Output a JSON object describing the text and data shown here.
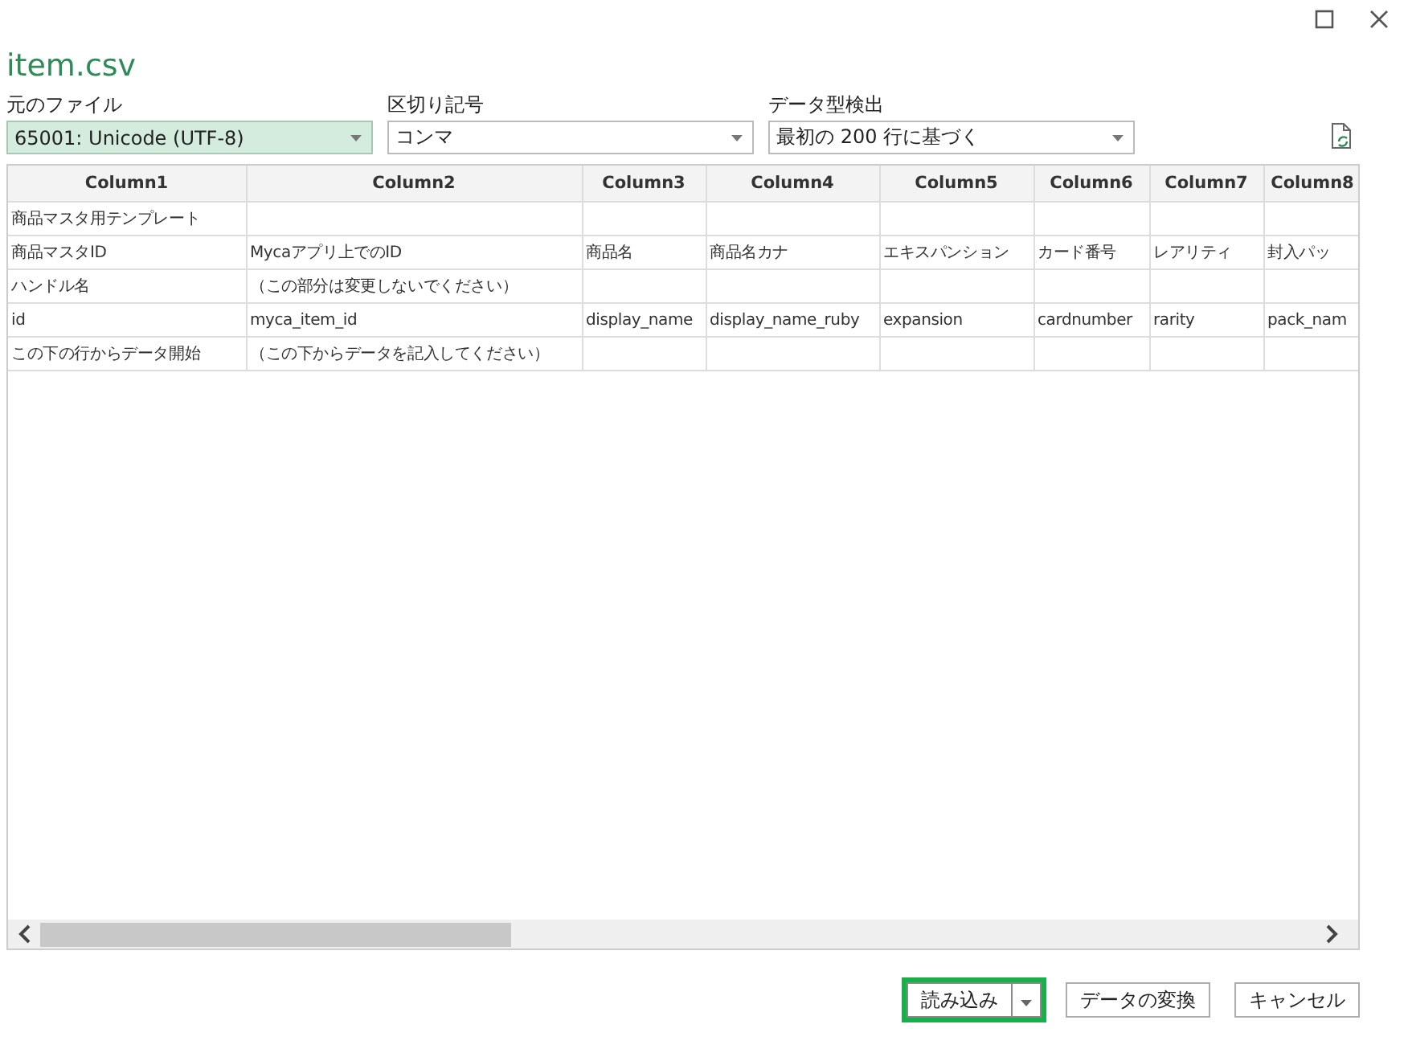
{
  "window": {
    "title": "item.csv"
  },
  "options": [
    {
      "label": "元のファイル",
      "value": "65001: Unicode (UTF-8)",
      "selected": true
    },
    {
      "label": "区切り記号",
      "value": "コンマ",
      "selected": false
    },
    {
      "label": "データ型検出",
      "value": "最初の 200 行に基づく",
      "selected": false
    }
  ],
  "table": {
    "columns": [
      "Column1",
      "Column2",
      "Column3",
      "Column4",
      "Column5",
      "Column6",
      "Column7",
      "Column8"
    ],
    "rows": [
      [
        "商品マスタ用テンプレート",
        "",
        "",
        "",
        "",
        "",
        "",
        ""
      ],
      [
        "商品マスタID",
        "Mycaアプリ上でのID",
        "商品名",
        "商品名カナ",
        "エキスパンション",
        "カード番号",
        "レアリティ",
        "封入パッ"
      ],
      [
        "ハンドル名",
        "（この部分は変更しないでください）",
        "",
        "",
        "",
        "",
        "",
        ""
      ],
      [
        "id",
        "myca_item_id",
        "display_name",
        "display_name_ruby",
        "expansion",
        "cardnumber",
        "rarity",
        "pack_nam"
      ],
      [
        "この下の行からデータ開始",
        "（この下からデータを記入してください）",
        "",
        "",
        "",
        "",
        "",
        ""
      ]
    ]
  },
  "buttons": [
    {
      "label": "読み込み",
      "kind": "split",
      "highlighted": true
    },
    {
      "label": "データの変換",
      "kind": "plain",
      "highlighted": false
    },
    {
      "label": "キャンセル",
      "kind": "plain",
      "highlighted": false
    }
  ]
}
